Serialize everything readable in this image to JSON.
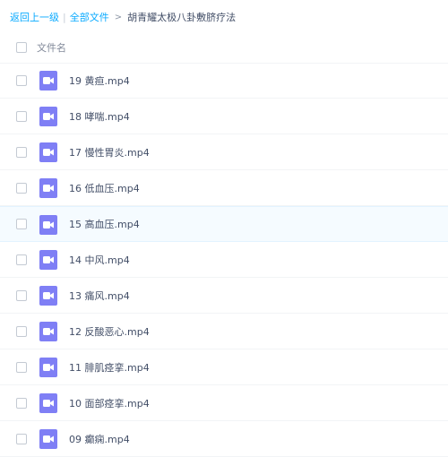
{
  "breadcrumb": {
    "back": "返回上一级",
    "separator": "|",
    "all_files": "全部文件",
    "arrow": ">",
    "current": "胡青耀太极八卦敷脐疗法"
  },
  "header": {
    "column_label": "文件名"
  },
  "files": [
    {
      "name": "19 黄疸.mp4",
      "icon": "video-file-icon"
    },
    {
      "name": "18 哮喘.mp4",
      "icon": "video-file-icon"
    },
    {
      "name": "17 慢性胃炎.mp4",
      "icon": "video-file-icon"
    },
    {
      "name": "16 低血压.mp4",
      "icon": "video-file-icon"
    },
    {
      "name": "15 高血压.mp4",
      "icon": "video-file-icon"
    },
    {
      "name": "14 中风.mp4",
      "icon": "video-file-icon"
    },
    {
      "name": "13 痛风.mp4",
      "icon": "video-file-icon"
    },
    {
      "name": "12 反酸恶心.mp4",
      "icon": "video-file-icon"
    },
    {
      "name": "11 腓肌痉挛.mp4",
      "icon": "video-file-icon"
    },
    {
      "name": "10 面部痉挛.mp4",
      "icon": "video-file-icon"
    },
    {
      "name": "09 癫痫.mp4",
      "icon": "video-file-icon"
    }
  ],
  "hovered_index": 4,
  "colors": {
    "accent": "#09aaff",
    "video_icon": "#7f7ff5",
    "hover_row": "#f5fbff"
  }
}
